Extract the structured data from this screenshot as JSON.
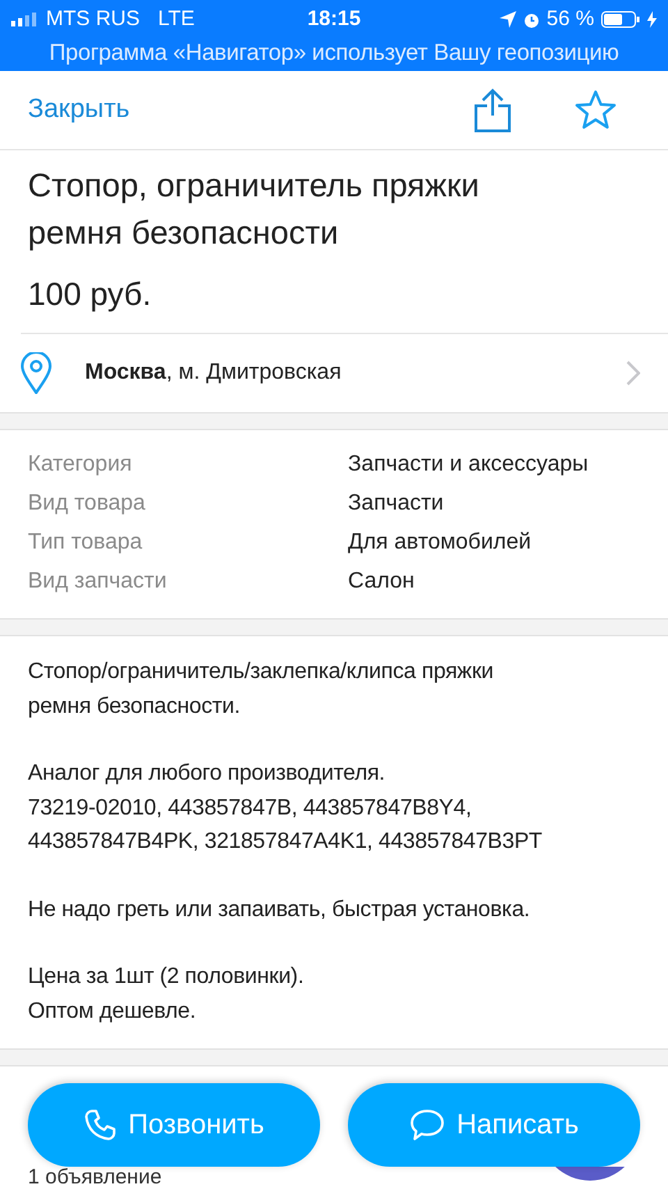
{
  "status_bar": {
    "carrier": "MTS RUS",
    "network": "LTE",
    "time": "18:15",
    "battery": "56 %"
  },
  "location_banner": "Программа «Навигатор» использует Вашу геопозицию",
  "nav": {
    "close": "Закрыть"
  },
  "title": "Стопор, ограничитель пряжки ремня безопасности",
  "price": "100 руб.",
  "location": {
    "city": "Москва",
    "metro": ", м. Дмитровская"
  },
  "specs": [
    {
      "label": "Категория",
      "value": "Запчасти и аксессуары"
    },
    {
      "label": "Вид товара",
      "value": "Запчасти"
    },
    {
      "label": "Тип товара",
      "value": "Для автомобилей"
    },
    {
      "label": "Вид запчасти",
      "value": "Салон"
    }
  ],
  "description": [
    "Стопор/ограничитель/заклепка/клипса пряжки\nремня безопасности.",
    "Аналог для любого производителя.\n73219-02010, 443857847B, 443857847B8Y4,\n443857847B4PK, 321857847A4K1, 443857847B3PT",
    "Не надо греть или запаивать, быстрая установка.",
    "Цена за 1шт (2 половинки).\nОптом дешевле."
  ],
  "seller": {
    "ads_count": "1 объявление"
  },
  "actions": [
    {
      "kind": "call",
      "label": "Позвонить"
    },
    {
      "kind": "message",
      "label": "Написать"
    }
  ]
}
